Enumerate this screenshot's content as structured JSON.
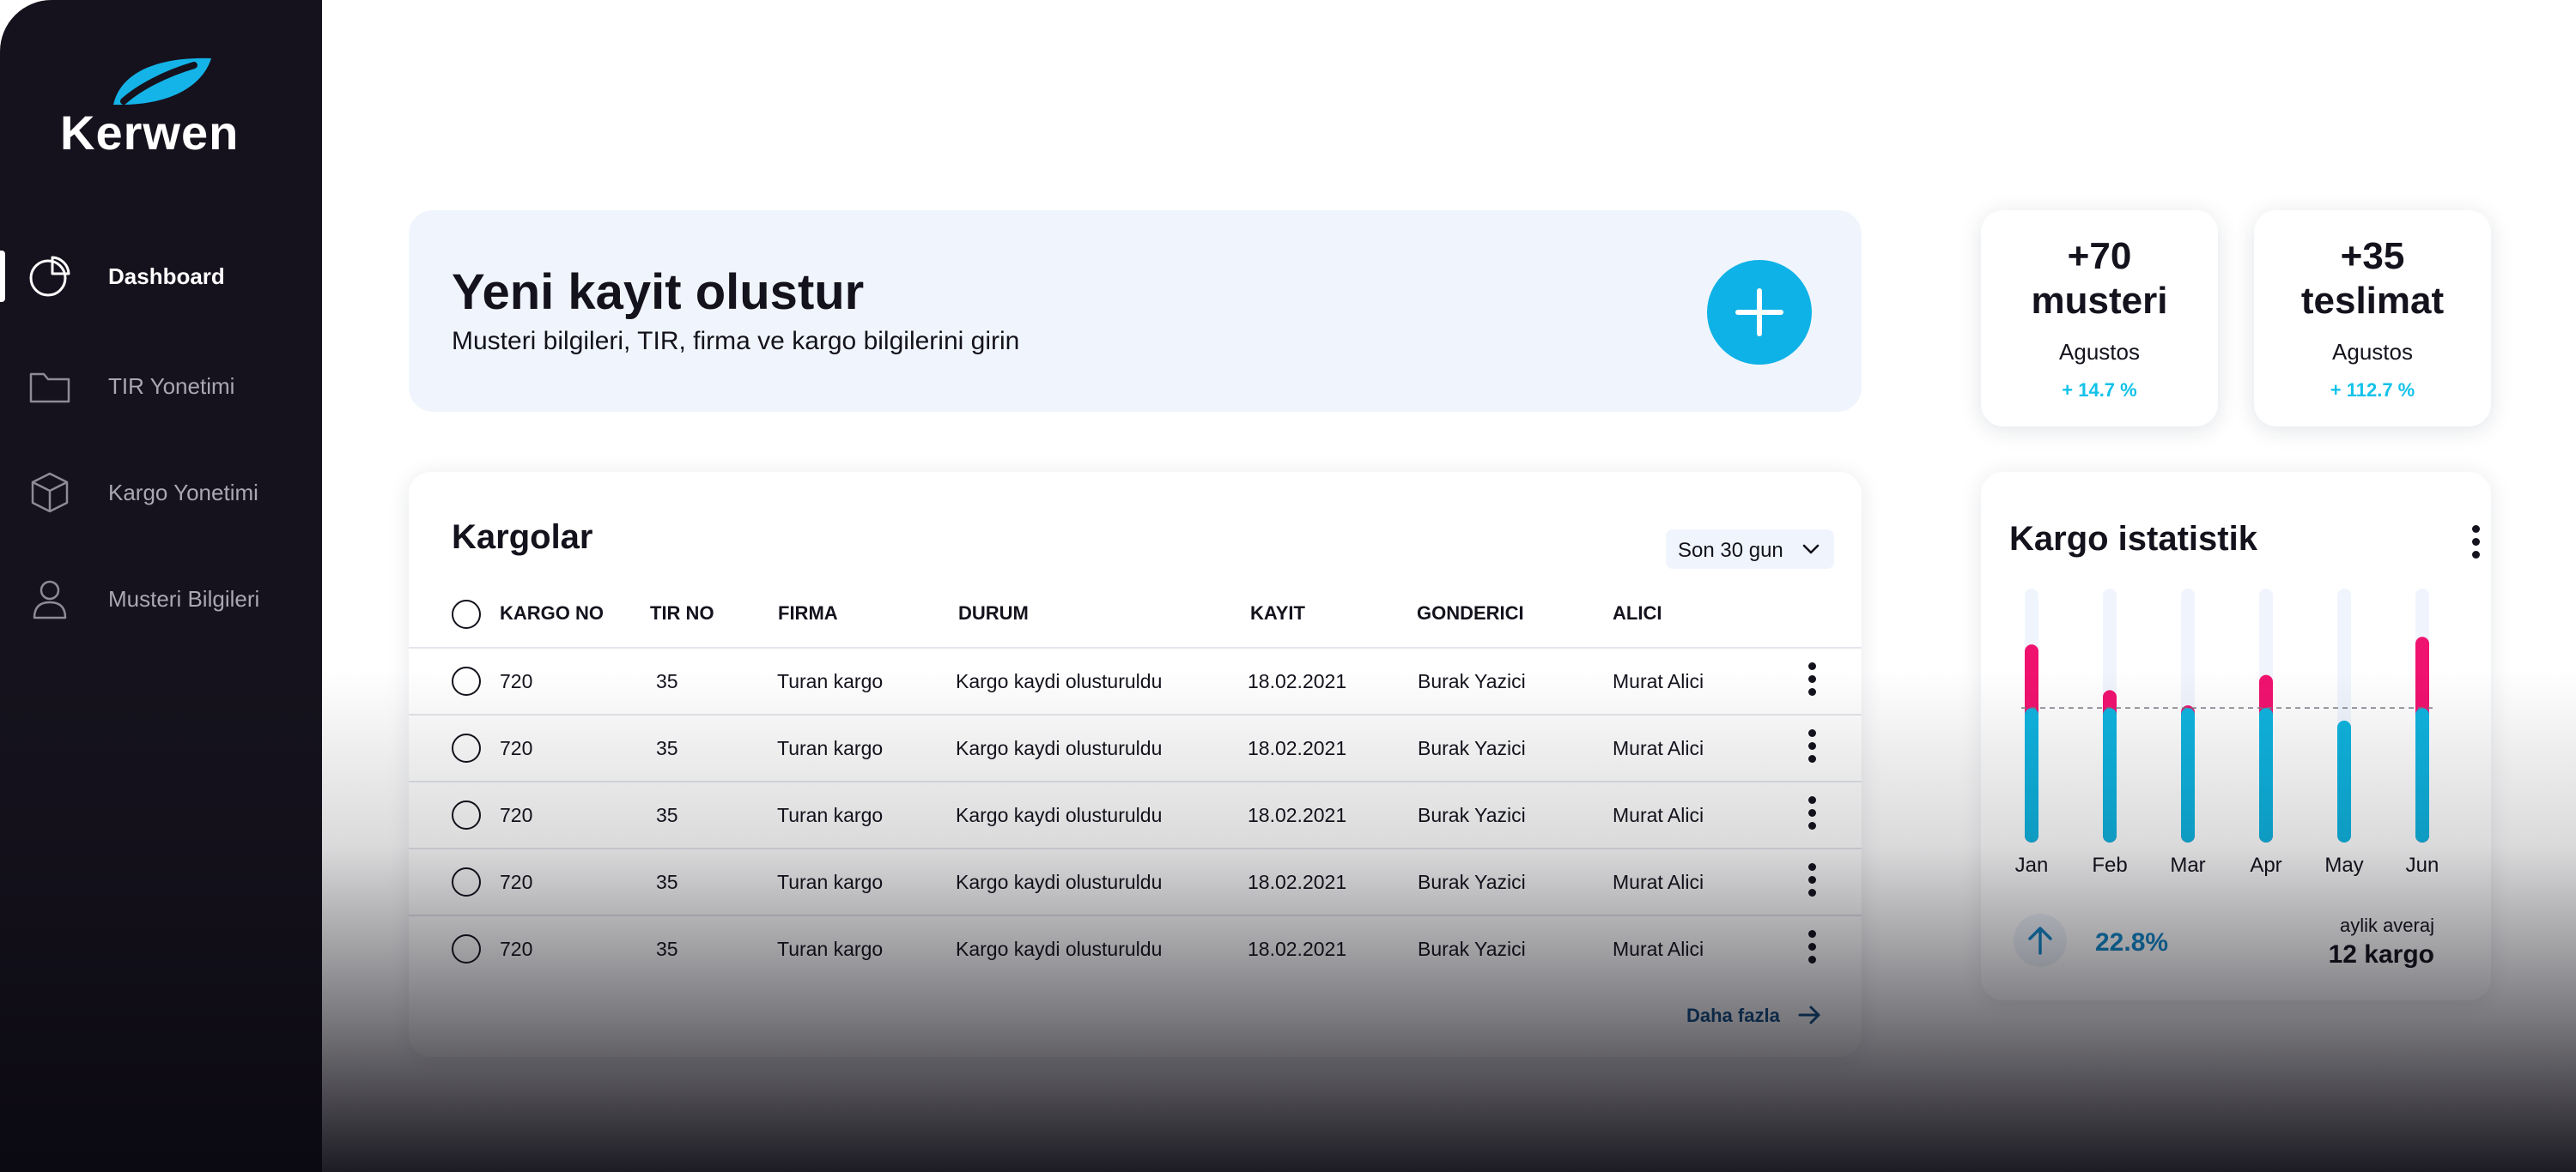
{
  "brand": {
    "name": "Kerwen",
    "logo_color": "#14b4e8"
  },
  "sidebar": {
    "items": [
      {
        "label": "Dashboard",
        "icon": "pie-chart-icon",
        "active": true
      },
      {
        "label": "TIR Yonetimi",
        "icon": "folder-icon",
        "active": false
      },
      {
        "label": "Kargo Yonetimi",
        "icon": "box-icon",
        "active": false
      },
      {
        "label": "Musteri Bilgileri",
        "icon": "user-icon",
        "active": false
      }
    ]
  },
  "new_record": {
    "title": "Yeni kayit olustur",
    "subtitle": "Musteri bilgileri, TIR, firma ve kargo bilgilerini girin",
    "button_icon": "plus-icon"
  },
  "stats": [
    {
      "value": "+70",
      "label": "musteri",
      "month": "Agustos",
      "change": "+ 14.7 %"
    },
    {
      "value": "+35",
      "label": "teslimat",
      "month": "Agustos",
      "change": "+ 112.7 %"
    }
  ],
  "cargo_table": {
    "title": "Kargolar",
    "period": "Son 30 gun",
    "columns": [
      "KARGO NO",
      "TIR NO",
      "FIRMA",
      "DURUM",
      "KAYIT",
      "GONDERICI",
      "ALICI"
    ],
    "rows": [
      [
        "720",
        "35",
        "Turan kargo",
        "Kargo kaydi olusturuldu",
        "18.02.2021",
        "Burak Yazici",
        "Murat Alici"
      ],
      [
        "720",
        "35",
        "Turan kargo",
        "Kargo kaydi olusturuldu",
        "18.02.2021",
        "Burak Yazici",
        "Murat Alici"
      ],
      [
        "720",
        "35",
        "Turan kargo",
        "Kargo kaydi olusturuldu",
        "18.02.2021",
        "Burak Yazici",
        "Murat Alici"
      ],
      [
        "720",
        "35",
        "Turan kargo",
        "Kargo kaydi olusturuldu",
        "18.02.2021",
        "Burak Yazici",
        "Murat Alici"
      ],
      [
        "720",
        "35",
        "Turan kargo",
        "Kargo kaydi olusturuldu",
        "18.02.2021",
        "Burak Yazici",
        "Murat Alici"
      ]
    ],
    "more_label": "Daha fazla"
  },
  "cargo_stats": {
    "title": "Kargo istatistik",
    "growth": "22.8%",
    "avg_label": "aylik averaj",
    "avg_value": "12 kargo",
    "colors": {
      "base": "#0fb4e0",
      "over": "#f0126f",
      "track": "#f0f5fd",
      "average_line": "#7a7a84"
    }
  },
  "chart_data": {
    "type": "bar",
    "categories": [
      "Jan",
      "Feb",
      "Mar",
      "Apr",
      "May",
      "Jun"
    ],
    "values": [
      0.78,
      0.6,
      0.54,
      0.66,
      0.48,
      0.81
    ],
    "average": 0.53,
    "ylim": [
      0,
      1
    ],
    "xlabel": "",
    "ylabel": "",
    "grid": false,
    "legend": "none"
  },
  "colors": {
    "accent": "#0fb2e6",
    "sidebar": "#15121d",
    "card_bg": "#f0f5fd",
    "link": "#0f4e86"
  }
}
